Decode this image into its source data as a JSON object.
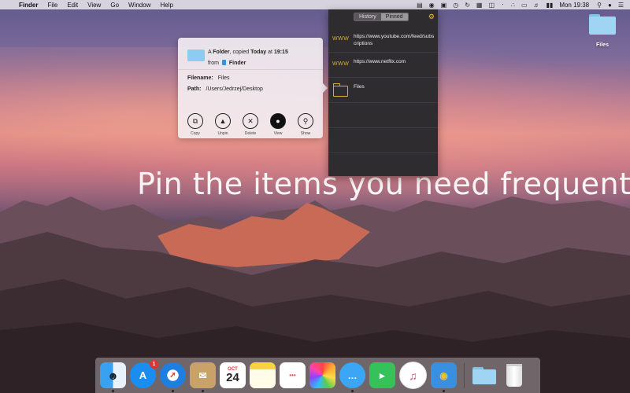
{
  "menubar": {
    "apple": "",
    "app": "Finder",
    "menus": [
      "File",
      "Edit",
      "View",
      "Go",
      "Window",
      "Help"
    ],
    "clock": "Mon 19:38"
  },
  "desktop": {
    "folder_label": "Files"
  },
  "tagline": "Pin the items you need frequently",
  "info_popup": {
    "type_prefix": "A ",
    "type": "Folder",
    "copied_text": ", copied ",
    "when": "Today",
    "at_text": " at ",
    "time": "19:15",
    "from_text": "from ",
    "source_app": "Finder",
    "filename_label": "Filename:",
    "filename_value": "Files",
    "path_label": "Path:",
    "path_value": "/Users/Jedrzej/Desktop",
    "actions": [
      {
        "label": "Copy",
        "icon": "copy-icon"
      },
      {
        "label": "Unpin",
        "icon": "pin-icon"
      },
      {
        "label": "Delete",
        "icon": "delete-icon"
      },
      {
        "label": "View",
        "icon": "view-icon"
      },
      {
        "label": "Show",
        "icon": "magnifier-icon"
      }
    ]
  },
  "history_panel": {
    "tabs": [
      "History",
      "Pinned"
    ],
    "items": [
      {
        "kind": "WWW",
        "text": "https://www.youtube.com/feed/subscriptions"
      },
      {
        "kind": "WWW",
        "text": "https://www.netflix.com"
      },
      {
        "kind": "folder",
        "text": "Files"
      }
    ]
  },
  "dock": {
    "app_store_badge": "1",
    "calendar_month": "OCT",
    "calendar_day": "24"
  }
}
